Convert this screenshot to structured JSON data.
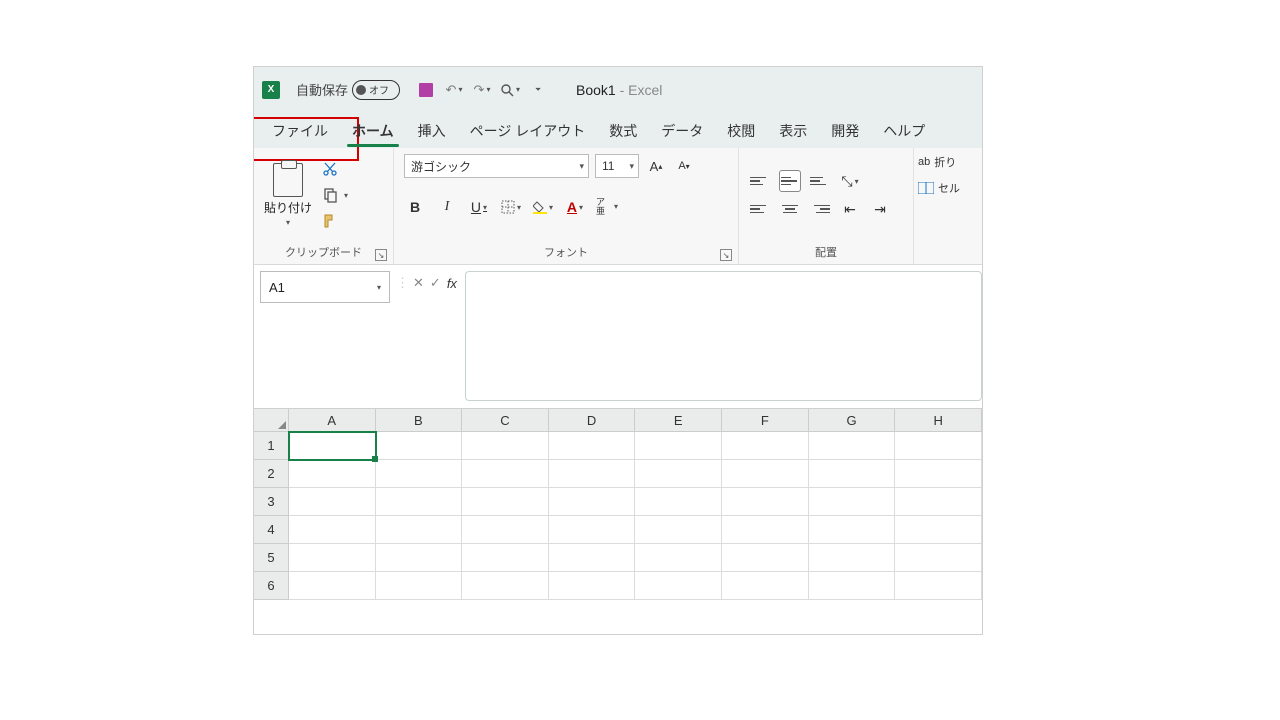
{
  "titlebar": {
    "autosave_label": "自動保存",
    "autosave_state": "オフ",
    "doc_name": "Book1",
    "app_sep": "  -  ",
    "app_name": "Excel"
  },
  "tabs": {
    "file": "ファイル",
    "home": "ホーム",
    "insert": "挿入",
    "page_layout": "ページ レイアウト",
    "formulas": "数式",
    "data": "データ",
    "review": "校閲",
    "view": "表示",
    "developer": "開発",
    "help": "ヘルプ"
  },
  "ribbon": {
    "clipboard": {
      "paste": "貼り付け",
      "label": "クリップボード"
    },
    "font": {
      "name": "游ゴシック",
      "size": "11",
      "label": "フォント",
      "ruby": "ア亜"
    },
    "align": {
      "label": "配置"
    },
    "wrap": "折り",
    "cells": "セル"
  },
  "fx": {
    "cellref": "A1",
    "fx_symbol": "fx"
  },
  "columns": [
    "A",
    "B",
    "C",
    "D",
    "E",
    "F",
    "G",
    "H"
  ],
  "rows": [
    "1",
    "2",
    "3",
    "4",
    "5",
    "6"
  ]
}
